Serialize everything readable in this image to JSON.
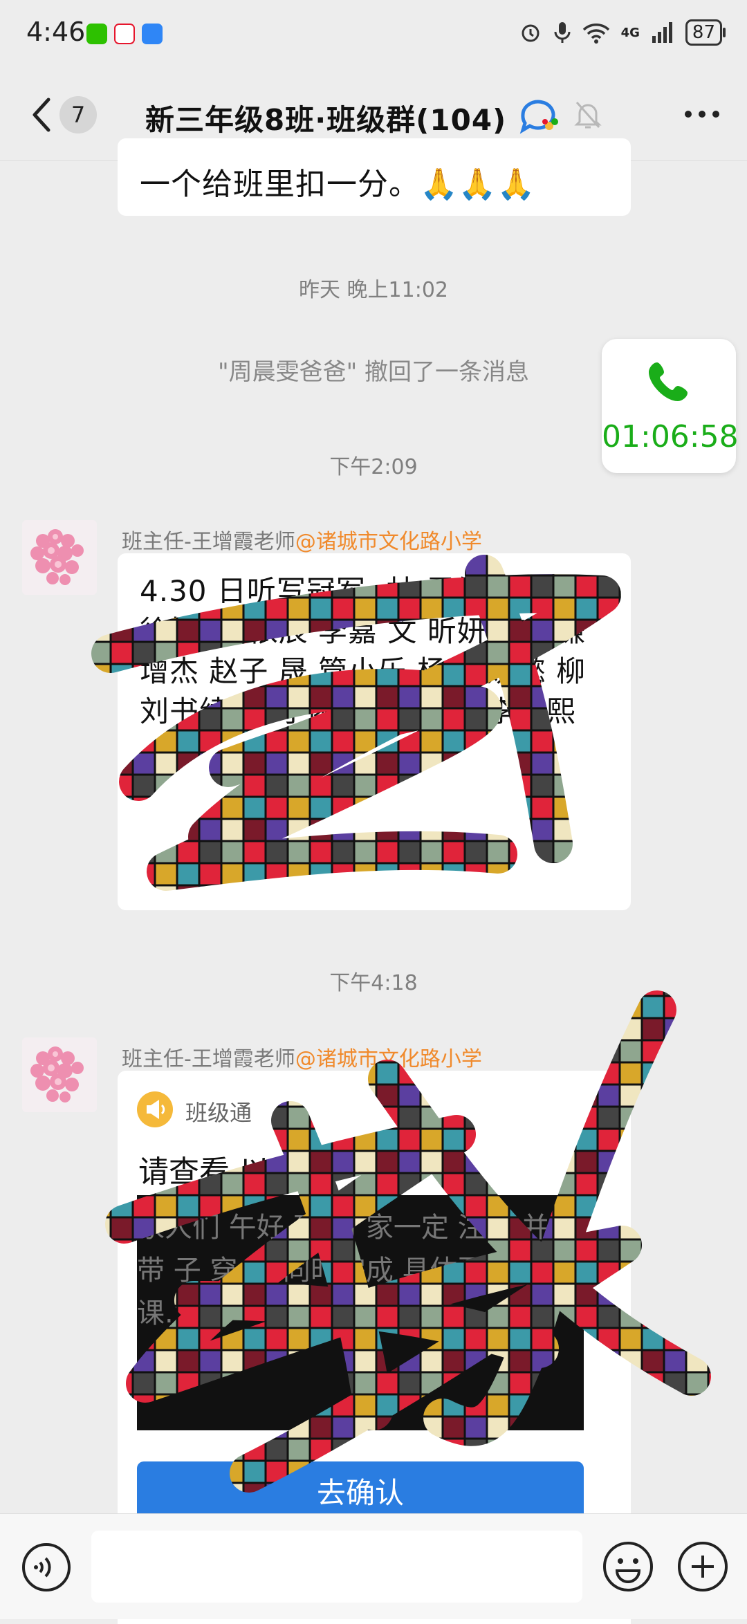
{
  "status_bar": {
    "time": "4:46",
    "network": "4G",
    "battery": "87",
    "app_icons": [
      "wechat-icon",
      "weibo-icon",
      "shield-icon"
    ]
  },
  "nav": {
    "unread_count": "7",
    "title": "新三年级8班·班级群(104)"
  },
  "messages": {
    "top_fragment": "一个给班里扣一分。🙏🙏🙏",
    "time_yesterday": "昨天 晚上11:02",
    "recall_notice": "\"周晨雯爸爸\" 撤回了一条消息",
    "time_1": "下午2:09",
    "msg1_sender": "班主任-王增霞老师",
    "msg1_org": "@诸城市文化路小学",
    "msg1_text": "4.30 日听写冠军: 林 雯轩 王梓铭 徐博 燕 依辰 李嘉 文 昕妍 李易谦 增杰 赵子 晟 管小乐 杨 王婉懿 柳 刘书续 惠 子函 刘 王翌轩 李泽熙",
    "time_2": "下午4:18",
    "msg2_sender": "班主任-王增霞老师",
    "msg2_org": "@诸城市文化路小学",
    "notice_label": "班级通",
    "notice_title": "请查看 以下通",
    "notice_preview": "家人们 午好 到 请 家一定 注孩 并 带 子 穿 两 同时完成 具体要 : 课...",
    "confirm_label": "去确认"
  },
  "call_float": {
    "duration": "01:06:58"
  },
  "colors": {
    "accent_green": "#1aad19",
    "org_orange": "#f08a2c",
    "button_blue": "#2a7de1"
  }
}
